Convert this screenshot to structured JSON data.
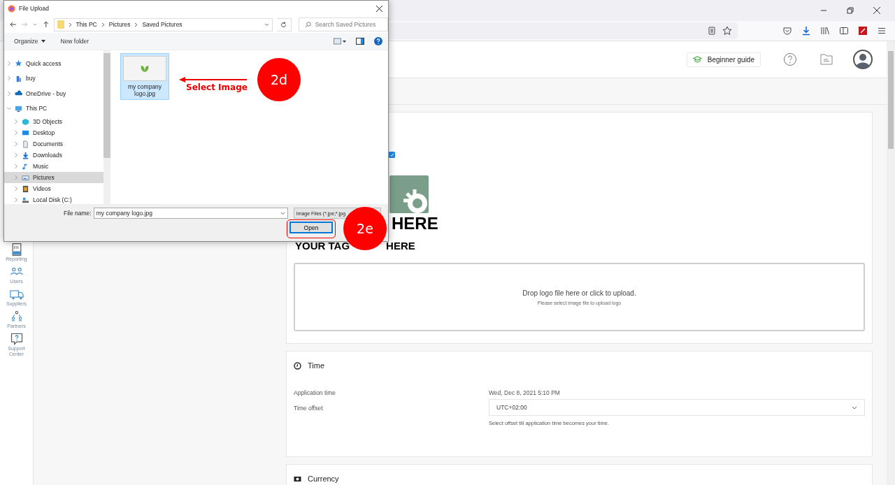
{
  "app_header": {
    "guide_button": "Beginner guide"
  },
  "sidebar": {
    "items": [
      {
        "kind": "report",
        "label": "Reporting"
      },
      {
        "kind": "users",
        "label": "Users"
      },
      {
        "kind": "truck",
        "label": "Suppliers"
      },
      {
        "kind": "partners",
        "label": "Partners"
      },
      {
        "kind": "support",
        "label": "Support Center"
      }
    ]
  },
  "logo_card": {
    "logo_title": "HERE",
    "tagline_parts": [
      "YOUR TAG",
      "HERE"
    ],
    "dropzone": {
      "title": "Drop logo file here or click to upload.",
      "hint": "Please select image file to upload logo"
    }
  },
  "time_card": {
    "title": "Time",
    "rows": [
      {
        "kind": "text",
        "label": "Application time",
        "value": "Wed, Dec 8, 2021 5:10 PM"
      },
      {
        "kind": "select",
        "label": "Time offset",
        "value": "UTC+02:00",
        "help": "Select offset till application time becomes your time."
      }
    ]
  },
  "currency_card": {
    "title": "Currency"
  },
  "dialog": {
    "title": "File Upload",
    "breadcrumb": [
      "This PC",
      "Pictures",
      "Saved Pictures"
    ],
    "search": {
      "placeholder": "Search Saved Pictures"
    },
    "toolbar": [
      "Organize",
      "New folder"
    ],
    "nav": [
      {
        "kind": "star",
        "label": "Quick access",
        "selected": false,
        "expanded": false
      },
      {
        "kind": "building",
        "label": "buy",
        "selected": false,
        "expanded": false
      },
      {
        "kind": "cloud",
        "label": "OneDrive - buy",
        "selected": false,
        "expanded": false
      },
      {
        "kind": "monitor",
        "label": "This PC",
        "selected": false,
        "expanded": true,
        "children": [
          {
            "kind": "cube",
            "label": "3D Objects",
            "selected": false,
            "expanded": false
          },
          {
            "kind": "desktop",
            "label": "Desktop",
            "selected": false,
            "expanded": false
          },
          {
            "kind": "document",
            "label": "Documents",
            "selected": false,
            "expanded": false
          },
          {
            "kind": "download",
            "label": "Downloads",
            "selected": false,
            "expanded": false
          },
          {
            "kind": "music",
            "label": "Music",
            "selected": false,
            "expanded": false
          },
          {
            "kind": "pictures",
            "label": "Pictures",
            "selected": true,
            "expanded": false
          },
          {
            "kind": "video",
            "label": "Videos",
            "selected": false,
            "expanded": false
          },
          {
            "kind": "disk",
            "label": "Local Disk (C:)",
            "selected": false,
            "expanded": false
          }
        ]
      }
    ],
    "files": [
      {
        "name": "my company logo.jpg",
        "selected": true
      }
    ],
    "file_name_label": "File name:",
    "file_name": "my company logo.jpg",
    "file_type": "Image Files (*.jpe;*.jpg",
    "open_button": "Open"
  },
  "annotations": {
    "arrow_label": "Select Image",
    "badges": [
      "2d",
      "2e"
    ]
  }
}
